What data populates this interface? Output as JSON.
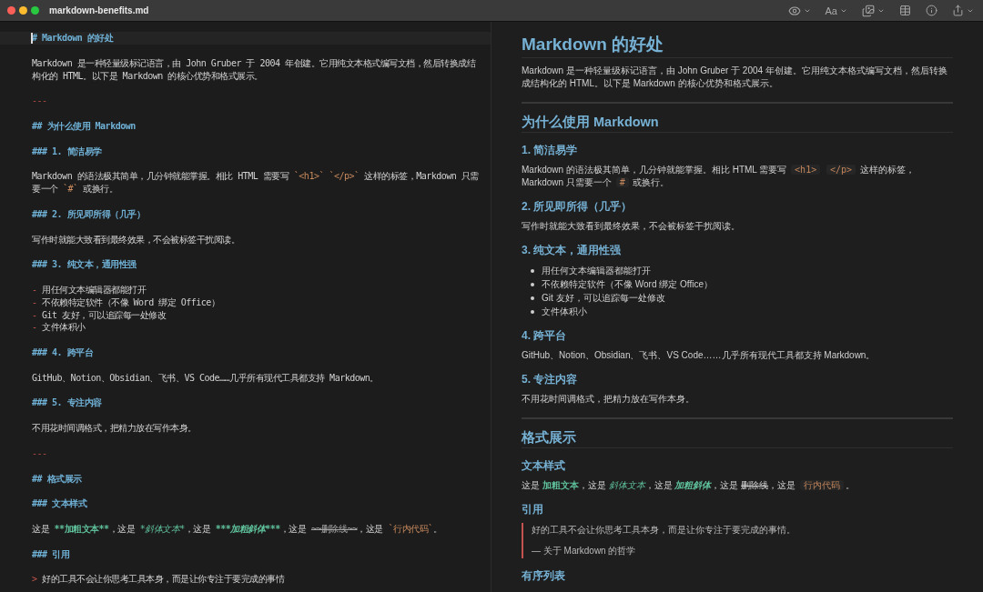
{
  "window": {
    "title": "markdown-benefits.md"
  },
  "toolbar": {
    "font_label": "Aa"
  },
  "source": {
    "blocks": [
      {
        "kind": "heading",
        "text": "# Markdown 的好处",
        "active": true
      },
      {
        "kind": "paragraph",
        "active": false,
        "parts": [
          {
            "kind": "text",
            "text": "Markdown 是一种轻量级标记语言，由 John Gruber 于 2004 年创建。它用纯文本格式编写文档，然后转换成结构化的 HTML。以下是 Markdown 的核心优势和格式展示。"
          }
        ]
      },
      {
        "kind": "rule",
        "text": "---",
        "active": false
      },
      {
        "kind": "heading",
        "text": "## 为什么使用 Markdown",
        "active": false
      },
      {
        "kind": "heading",
        "text": "### 1. 简洁易学",
        "active": false
      },
      {
        "kind": "paragraph",
        "active": false,
        "parts": [
          {
            "kind": "text",
            "text": "Markdown 的语法极其简单，几分钟就能掌握。相比 HTML 需要写 "
          },
          {
            "kind": "code_group",
            "items": [
              "`<h1>`",
              "`</p>`"
            ]
          },
          {
            "kind": "text",
            "text": " 这样的标签，Markdown 只需要一个 "
          },
          {
            "kind": "code",
            "text": "`#`"
          },
          {
            "kind": "text",
            "text": " 或换行。"
          }
        ]
      },
      {
        "kind": "heading",
        "text": "### 2. 所见即所得（几乎）",
        "active": false
      },
      {
        "kind": "paragraph",
        "active": false,
        "parts": [
          {
            "kind": "text",
            "text": "写作时就能大致看到最终效果，不会被标签干扰阅读。"
          }
        ]
      },
      {
        "kind": "heading",
        "text": "### 3. 纯文本，通用性强",
        "active": false
      },
      {
        "kind": "list",
        "active": false,
        "items": [
          {
            "marker": "-",
            "text": "用任何文本编辑器都能打开"
          },
          {
            "marker": "-",
            "text": "不依赖特定软件（不像 Word 绑定 Office）"
          },
          {
            "marker": "-",
            "text": "Git 友好，可以追踪每一处修改"
          },
          {
            "marker": "-",
            "text": "文件体积小"
          }
        ]
      },
      {
        "kind": "heading",
        "text": "### 4. 跨平台",
        "active": false
      },
      {
        "kind": "paragraph",
        "active": false,
        "parts": [
          {
            "kind": "text",
            "text": "GitHub、Notion、Obsidian、飞书、VS Code……几乎所有现代工具都支持 Markdown。"
          }
        ]
      },
      {
        "kind": "heading",
        "text": "### 5. 专注内容",
        "active": false
      },
      {
        "kind": "paragraph",
        "active": false,
        "parts": [
          {
            "kind": "text",
            "text": "不用花时间调格式，把精力放在写作本身。"
          }
        ]
      },
      {
        "kind": "rule",
        "text": "---",
        "active": false
      },
      {
        "kind": "heading",
        "text": "## 格式展示",
        "active": false
      },
      {
        "kind": "heading",
        "text": "### 文本样式",
        "active": false
      },
      {
        "kind": "paragraph",
        "active": false,
        "parts": [
          {
            "kind": "text",
            "text": "这是 "
          },
          {
            "kind": "bold",
            "text": "**加粗文本**"
          },
          {
            "kind": "text",
            "text": "，这是 "
          },
          {
            "kind": "italic",
            "text": "*斜体文本*"
          },
          {
            "kind": "text",
            "text": "，这是 "
          },
          {
            "kind": "bold_italic",
            "text": "***加粗斜体***"
          },
          {
            "kind": "text",
            "text": "，这是 "
          },
          {
            "kind": "strike",
            "text": "~~删除线~~"
          },
          {
            "kind": "text",
            "text": "，这是 "
          },
          {
            "kind": "code",
            "text": "`行内代码`"
          },
          {
            "kind": "text",
            "text": "。"
          }
        ]
      },
      {
        "kind": "heading",
        "text": "### 引用",
        "active": false
      },
      {
        "kind": "quote",
        "marker": ">",
        "text": "好的工具不会让你思考工具本身，而是让你专注于要完成的事情",
        "active": false
      }
    ]
  },
  "preview": {
    "blocks": [
      {
        "kind": "h1",
        "text": "Markdown 的好处"
      },
      {
        "kind": "paragraph",
        "parts": [
          {
            "kind": "text",
            "text": "Markdown 是一种轻量级标记语言，由 John Gruber 于 2004 年创建。它用纯文本格式编写文档，然后转换成结构化的 HTML。以下是 Markdown 的核心优势和格式展示。"
          }
        ]
      },
      {
        "kind": "rule"
      },
      {
        "kind": "h2",
        "text": "为什么使用 Markdown"
      },
      {
        "kind": "h3",
        "text": "1. 简洁易学"
      },
      {
        "kind": "paragraph",
        "parts": [
          {
            "kind": "text",
            "text": "Markdown 的语法极其简单，几分钟就能掌握。相比 HTML 需要写 "
          },
          {
            "kind": "code_group",
            "items": [
              "<h1>",
              "</p>"
            ]
          },
          {
            "kind": "text",
            "text": " 这样的标签，Markdown 只需要一个 "
          },
          {
            "kind": "code",
            "text": "#"
          },
          {
            "kind": "text",
            "text": " 或换行。"
          }
        ]
      },
      {
        "kind": "h3",
        "text": "2. 所见即所得（几乎）"
      },
      {
        "kind": "paragraph",
        "parts": [
          {
            "kind": "text",
            "text": "写作时就能大致看到最终效果，不会被标签干扰阅读。"
          }
        ]
      },
      {
        "kind": "h3",
        "text": "3. 纯文本，通用性强"
      },
      {
        "kind": "list",
        "items": [
          "用任何文本编辑器都能打开",
          "不依赖特定软件（不像 Word 绑定 Office）",
          "Git 友好，可以追踪每一处修改",
          "文件体积小"
        ]
      },
      {
        "kind": "h3",
        "text": "4. 跨平台"
      },
      {
        "kind": "paragraph",
        "parts": [
          {
            "kind": "text",
            "text": "GitHub、Notion、Obsidian、飞书、VS Code……几乎所有现代工具都支持 Markdown。"
          }
        ]
      },
      {
        "kind": "h3",
        "text": "5. 专注内容"
      },
      {
        "kind": "paragraph",
        "parts": [
          {
            "kind": "text",
            "text": "不用花时间调格式，把精力放在写作本身。"
          }
        ]
      },
      {
        "kind": "rule"
      },
      {
        "kind": "h2",
        "text": "格式展示"
      },
      {
        "kind": "h3",
        "text": "文本样式"
      },
      {
        "kind": "paragraph",
        "parts": [
          {
            "kind": "text",
            "text": "这是 "
          },
          {
            "kind": "bold",
            "text": "加粗文本"
          },
          {
            "kind": "text",
            "text": "，这是 "
          },
          {
            "kind": "italic",
            "text": "斜体文本"
          },
          {
            "kind": "text",
            "text": "，这是 "
          },
          {
            "kind": "bold_italic",
            "text": "加粗斜体"
          },
          {
            "kind": "text",
            "text": "，这是 "
          },
          {
            "kind": "strike",
            "text": "删除线"
          },
          {
            "kind": "text",
            "text": "，这是 "
          },
          {
            "kind": "code",
            "text": "行内代码"
          },
          {
            "kind": "text",
            "text": "。"
          }
        ]
      },
      {
        "kind": "h3",
        "text": "引用"
      },
      {
        "kind": "quote",
        "paragraphs": [
          "好的工具不会让你思考工具本身，而是让你专注于要完成的事情。",
          "— 关于 Markdown 的哲学"
        ]
      },
      {
        "kind": "h3",
        "text": "有序列表"
      }
    ]
  }
}
